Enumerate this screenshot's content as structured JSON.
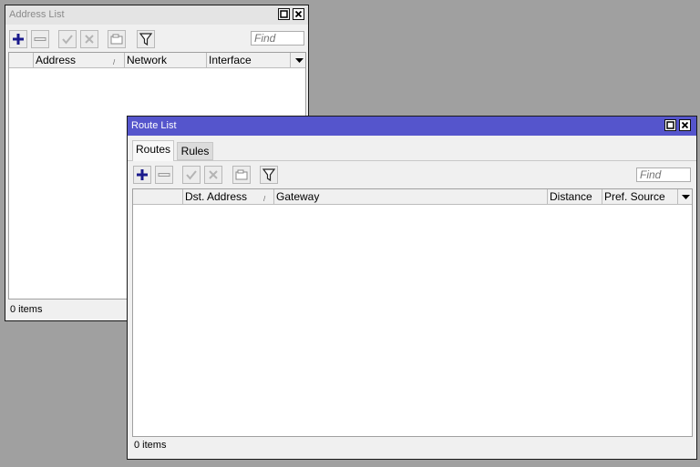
{
  "address_list": {
    "title": "Address List",
    "find_placeholder": "Find",
    "columns": [
      "Address",
      "Network",
      "Interface"
    ],
    "status": "0 items"
  },
  "route_list": {
    "title": "Route List",
    "tabs": [
      "Routes",
      "Rules"
    ],
    "active_tab": "Routes",
    "find_placeholder": "Find",
    "columns": [
      "Dst. Address",
      "Gateway",
      "Distance",
      "Pref. Source"
    ],
    "status": "0 items",
    "titlebar_color": "#5555cc"
  },
  "icons": [
    "add-icon",
    "remove-icon",
    "enable-icon",
    "disable-icon",
    "comment-icon",
    "filter-icon",
    "maximize-icon",
    "close-icon",
    "column-menu-icon"
  ]
}
